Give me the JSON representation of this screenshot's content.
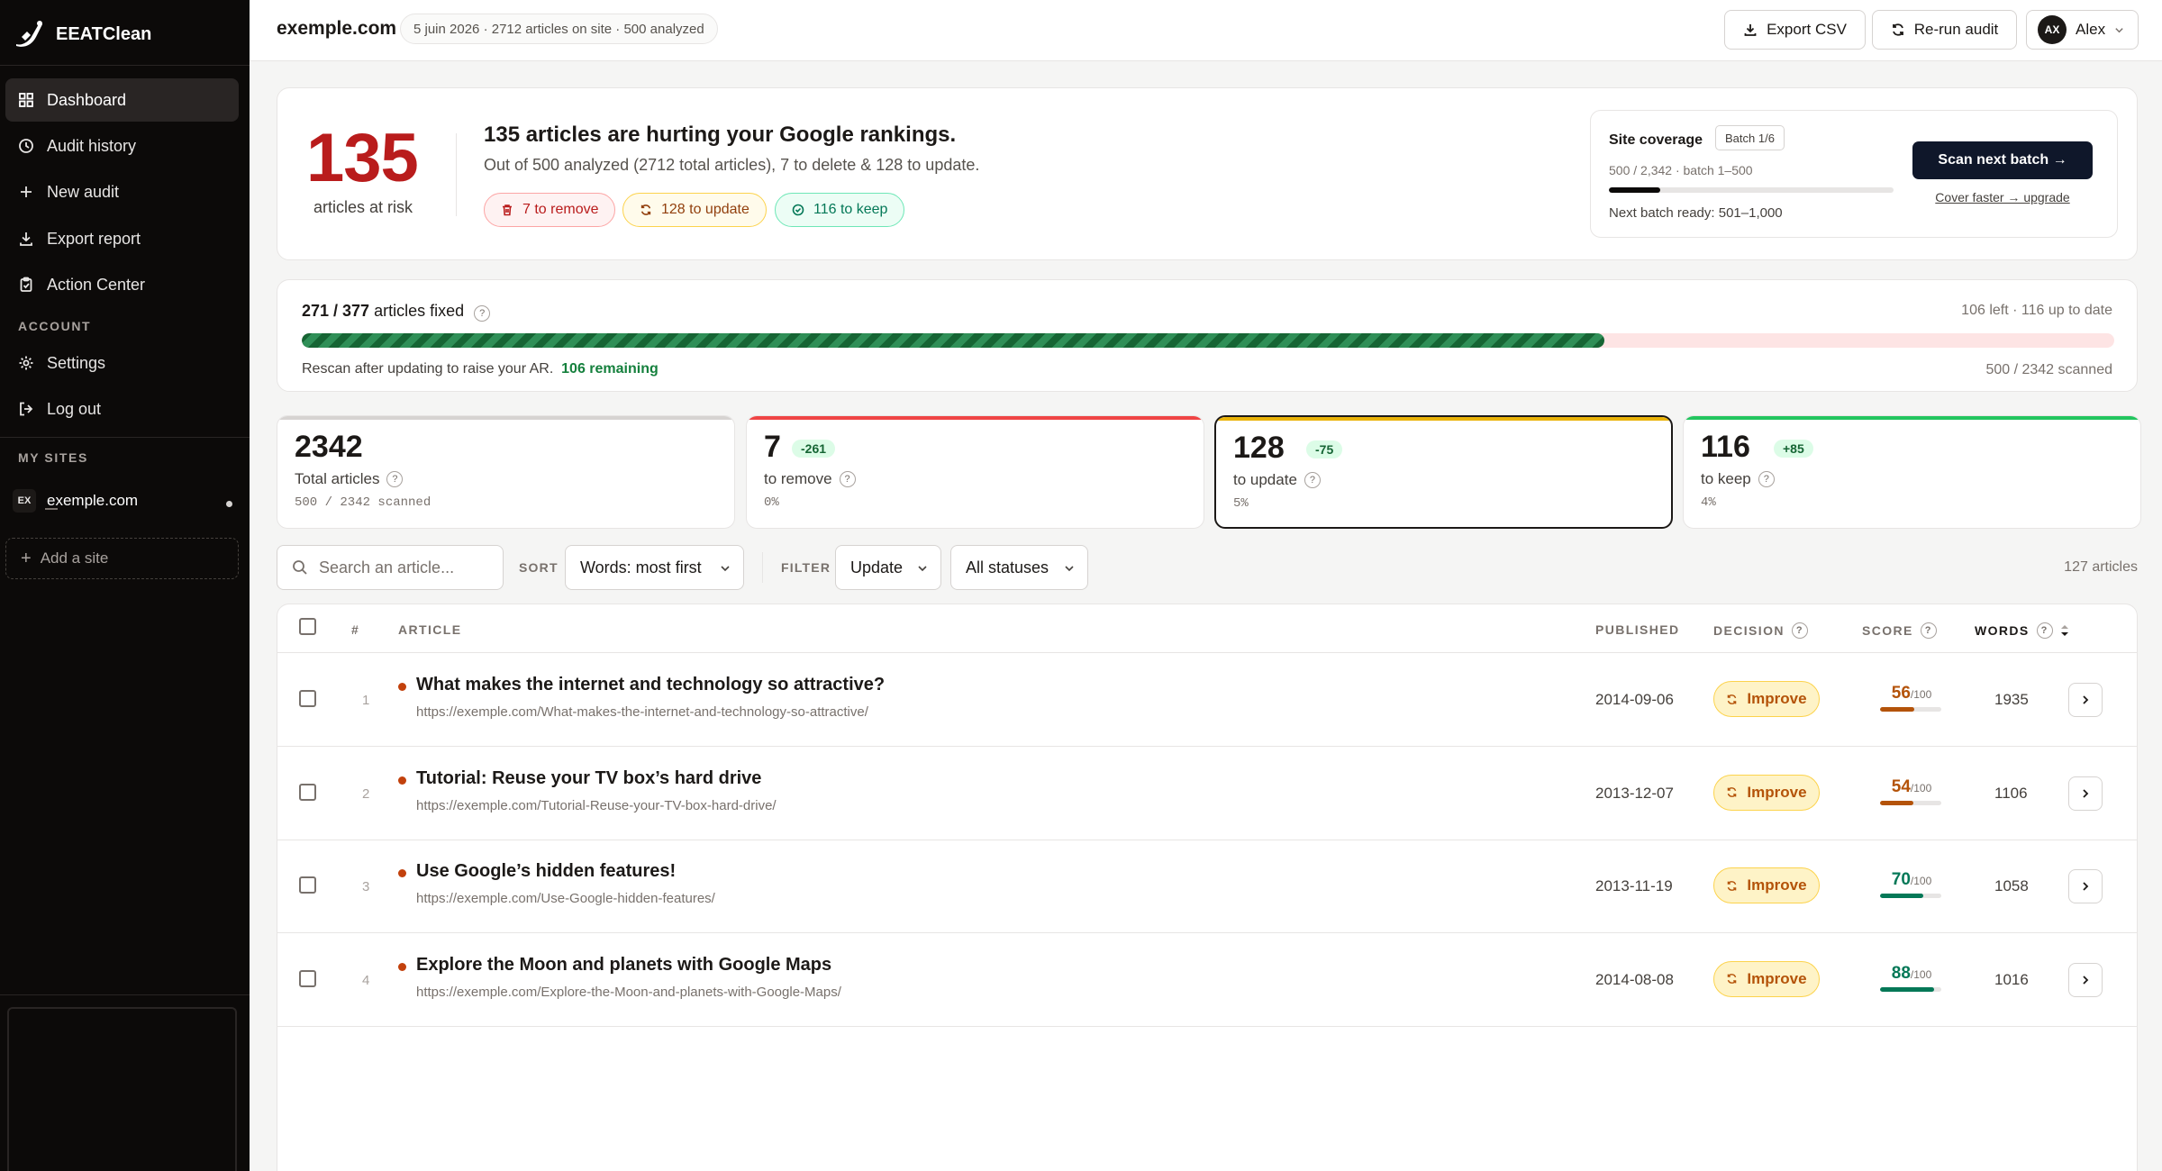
{
  "app": {
    "name": "EEATClean"
  },
  "sidebar": {
    "nav": [
      {
        "label": "Dashboard",
        "icon": "grid-icon",
        "active": true
      },
      {
        "label": "Audit history",
        "icon": "clock-icon"
      },
      {
        "label": "New audit",
        "icon": "plus-icon"
      },
      {
        "label": "Export report",
        "icon": "download-icon"
      },
      {
        "label": "Action Center",
        "icon": "clipboard-icon"
      }
    ],
    "account_heading": "ACCOUNT",
    "account": [
      {
        "label": "Settings",
        "icon": "gear-icon"
      },
      {
        "label": "Log out",
        "icon": "logout-icon"
      }
    ],
    "sites_heading": "MY SITES",
    "site": {
      "badge": "EX",
      "name": "exemple.com"
    },
    "add_site": "Add a site"
  },
  "header": {
    "domain": "exemple.com",
    "meta": "5 juin 2026 · 2712 articles on site · 500 analyzed",
    "export_label": "Export CSV",
    "rerun_label": "Re-run audit",
    "user": {
      "initials": "AX",
      "name": "Alex"
    }
  },
  "hero": {
    "count": "135",
    "count_label": "articles at risk",
    "title": "135 articles are hurting your Google rankings.",
    "subtitle": "Out of 500 analyzed (2712 total articles), 7 to delete & 128 to update.",
    "pills": {
      "remove": "7  to remove",
      "update": "128  to update",
      "keep": "116  to keep"
    },
    "coverage": {
      "title": "Site coverage",
      "batch": "Batch 1/6",
      "range": "500 / 2,342 · batch 1–500",
      "progress": 0.18,
      "next": "Next batch ready: 501–1,000",
      "scan_label": "Scan next batch →",
      "upgrade_label": "Cover faster → upgrade"
    }
  },
  "progress": {
    "title_count": "271 / 377",
    "title_text": " articles fixed",
    "right": "106 left · 116 up to date",
    "fraction": 0.7188,
    "note": "Rescan after updating to raise your AR.",
    "note_highlight": "106 remaining",
    "scanned": "500 / 2342 scanned"
  },
  "stats": [
    {
      "value": "2342",
      "label": "Total articles",
      "sub": "500 / 2342 scanned",
      "delta": "",
      "accent": "#d6d3d1"
    },
    {
      "value": "7",
      "label": "to remove",
      "sub": "0%",
      "delta": "-261",
      "accent": "#ef4444"
    },
    {
      "value": "128",
      "label": "to update",
      "sub": "5%",
      "delta": "-75",
      "accent": "#eab308"
    },
    {
      "value": "116",
      "label": "to keep",
      "sub": "4%",
      "delta": "+85",
      "accent": "#22c55e"
    }
  ],
  "filters": {
    "search_placeholder": "Search an article...",
    "sort_label": "SORT",
    "sort_value": "Words: most first",
    "filter_label": "FILTER",
    "filter_value": "Update",
    "status_value": "All statuses",
    "count": "127 articles"
  },
  "table": {
    "columns": {
      "index": "#",
      "article": "ARTICLE",
      "published": "PUBLISHED",
      "decision": "DECISION",
      "score": "SCORE",
      "words": "WORDS"
    },
    "rows": [
      {
        "index": "1",
        "title": "What makes the internet and technology so attractive?",
        "url": "https://exemple.com/What-makes-the-internet-and-technology-so-attractive/",
        "published": "2014-09-06",
        "decision": "Improve",
        "score": "56",
        "score_max": "/100",
        "words": "1935",
        "score_color": "#b45309"
      },
      {
        "index": "2",
        "title": "Tutorial: Reuse your TV box’s hard drive",
        "url": "https://exemple.com/Tutorial-Reuse-your-TV-box-hard-drive/",
        "published": "2013-12-07",
        "decision": "Improve",
        "score": "54",
        "score_max": "/100",
        "words": "1106",
        "score_color": "#b45309"
      },
      {
        "index": "3",
        "title": "Use Google’s hidden features!",
        "url": "https://exemple.com/Use-Google-hidden-features/",
        "published": "2013-11-19",
        "decision": "Improve",
        "score": "70",
        "score_max": "/100",
        "words": "1058",
        "score_color": "#047857"
      },
      {
        "index": "4",
        "title": "Explore the Moon and planets with Google Maps",
        "url": "https://exemple.com/Explore-the-Moon-and-planets-with-Google-Maps/",
        "published": "2014-08-08",
        "decision": "Improve",
        "score": "88",
        "score_max": "/100",
        "words": "1016",
        "score_color": "#047857"
      }
    ]
  }
}
